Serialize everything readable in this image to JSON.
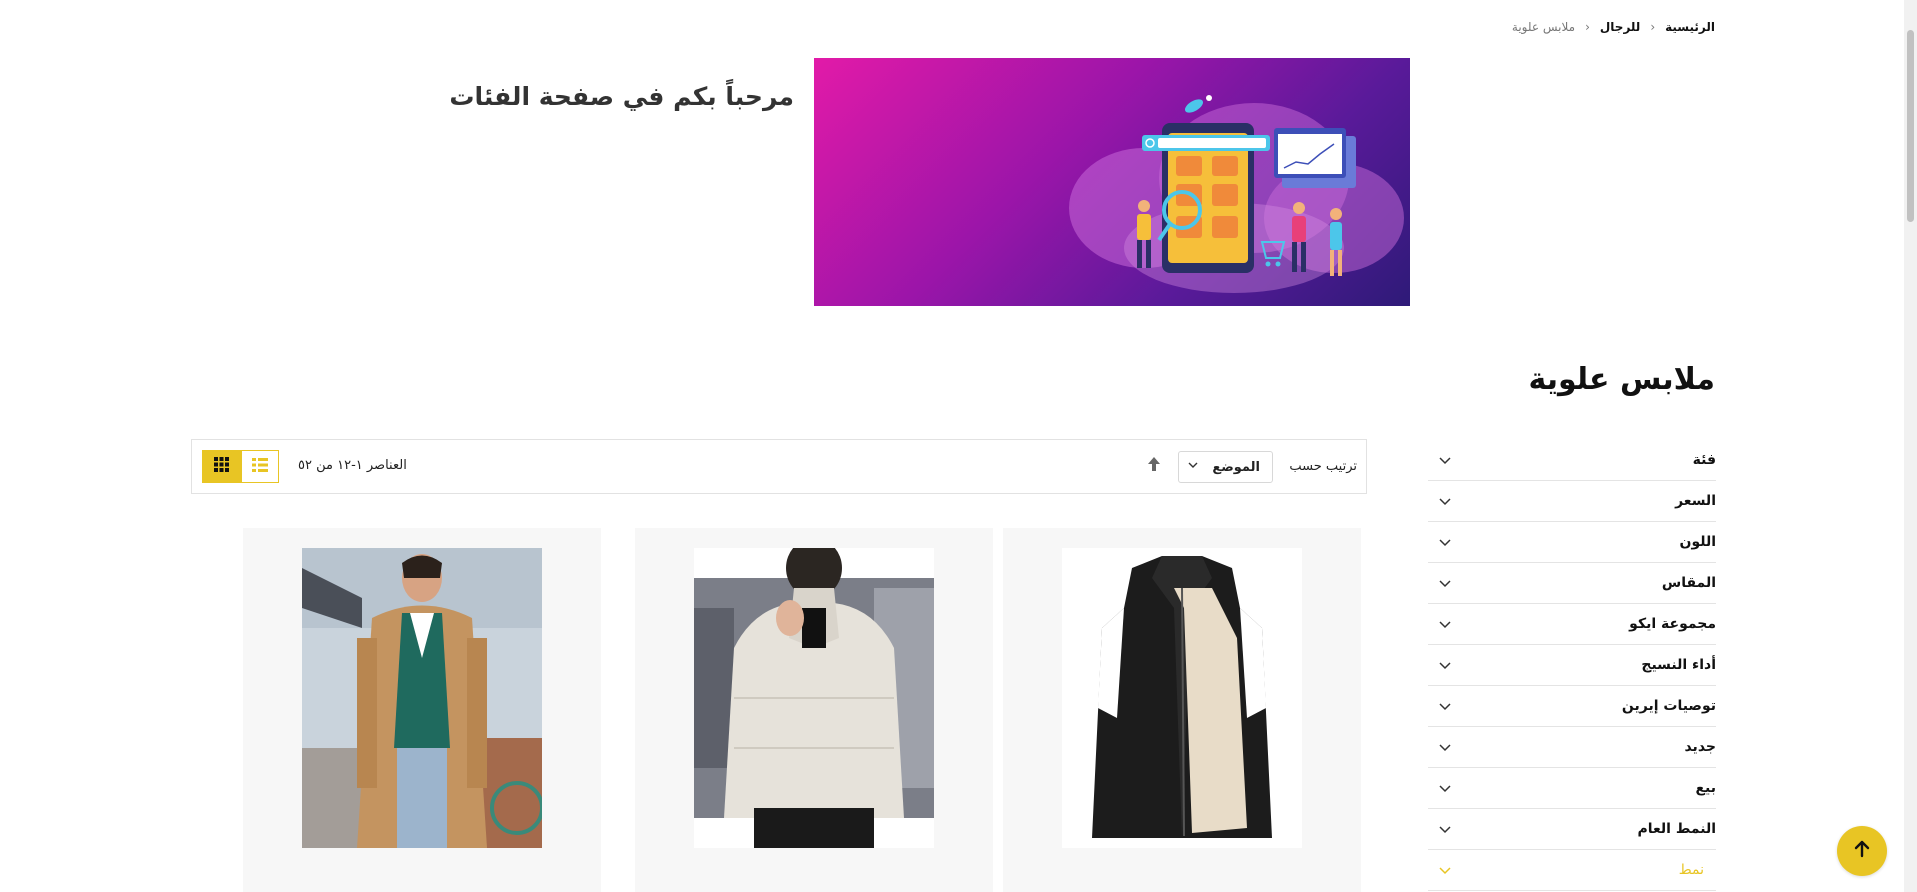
{
  "breadcrumb": {
    "home": "الرئيسية",
    "category": "للرجال",
    "current": "ملابس علوية"
  },
  "banner": {
    "welcome_text": "مرحباً بكم في صفحة الفئات"
  },
  "page_title": "ملابس علوية",
  "filters": [
    {
      "label": "فئة"
    },
    {
      "label": "السعر"
    },
    {
      "label": "اللون"
    },
    {
      "label": "المقاس"
    },
    {
      "label": "مجموعة ايكو"
    },
    {
      "label": "أداء النسيج"
    },
    {
      "label": "توصيات إيرين"
    },
    {
      "label": "جديد"
    },
    {
      "label": "بيع"
    },
    {
      "label": "النمط العام"
    },
    {
      "label": "نمط",
      "active": true
    }
  ],
  "toolbar": {
    "sort_label": "ترتيب حسب",
    "sort_value": "الموضع",
    "item_count": "العناصر ١-١٢ من ٥٢"
  },
  "products": [
    {
      "image": "black-fleece-vest"
    },
    {
      "image": "white-puffer-jacket"
    },
    {
      "image": "camel-coat-green-vest"
    }
  ],
  "colors": {
    "accent": "#e8c524",
    "text": "#111111",
    "muted": "#777777",
    "banner_start": "#e21aa8",
    "banner_end": "#2e1a78"
  },
  "icons": {
    "breadcrumb_separator": "chevron-left-icon",
    "filter_toggle": "chevron-down-icon",
    "sort_direction": "arrow-up-icon",
    "grid_view": "grid-icon",
    "list_view": "list-icon",
    "scroll_top": "arrow-up-icon"
  }
}
